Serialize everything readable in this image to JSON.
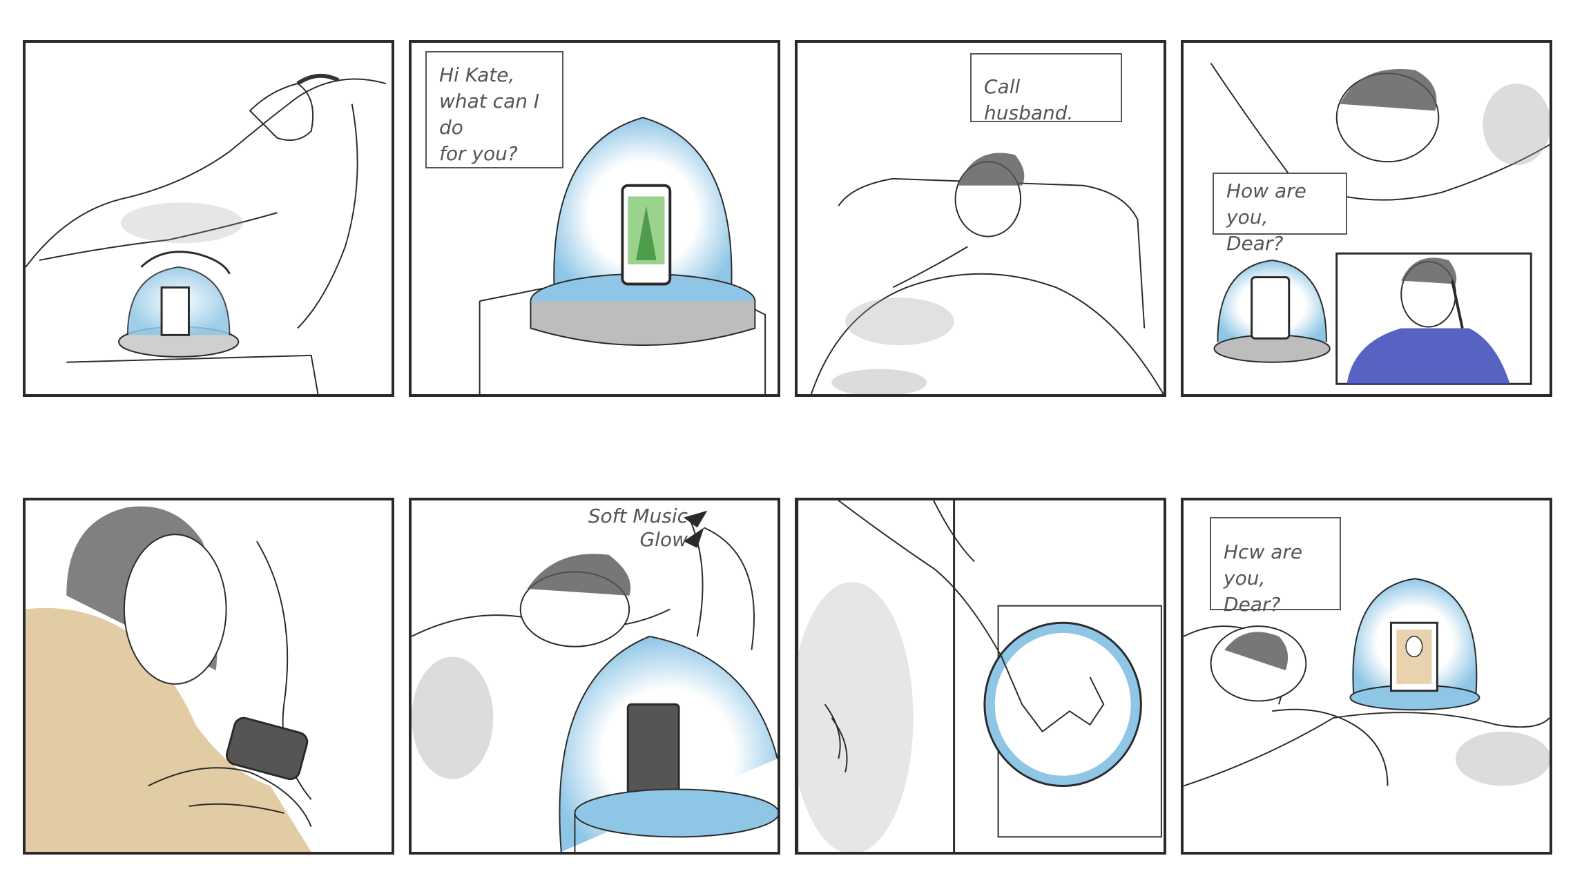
{
  "storyboard": {
    "panels": [
      {
        "id": "panel-1",
        "bubble": ""
      },
      {
        "id": "panel-2",
        "bubble": "Hi Kate,\nwhat can I do\nfor you?"
      },
      {
        "id": "panel-3",
        "bubble": "Call husband."
      },
      {
        "id": "panel-4",
        "bubble": "How are you,\nDear?"
      },
      {
        "id": "panel-5",
        "bubble": ""
      },
      {
        "id": "panel-6",
        "caption": "Soft Music\nGlow"
      },
      {
        "id": "panel-7",
        "bubble": ""
      },
      {
        "id": "panel-8",
        "bubble": "Hcw are you,\nDear?"
      }
    ]
  },
  "colors": {
    "line": "#2a2a2a",
    "glow": "#8fc6e6",
    "shade": "#9a9a9a",
    "shirt_blue": "#3b46b8",
    "sweater_tan": "#c9a25a",
    "screen_green": "#6fbf5e"
  }
}
